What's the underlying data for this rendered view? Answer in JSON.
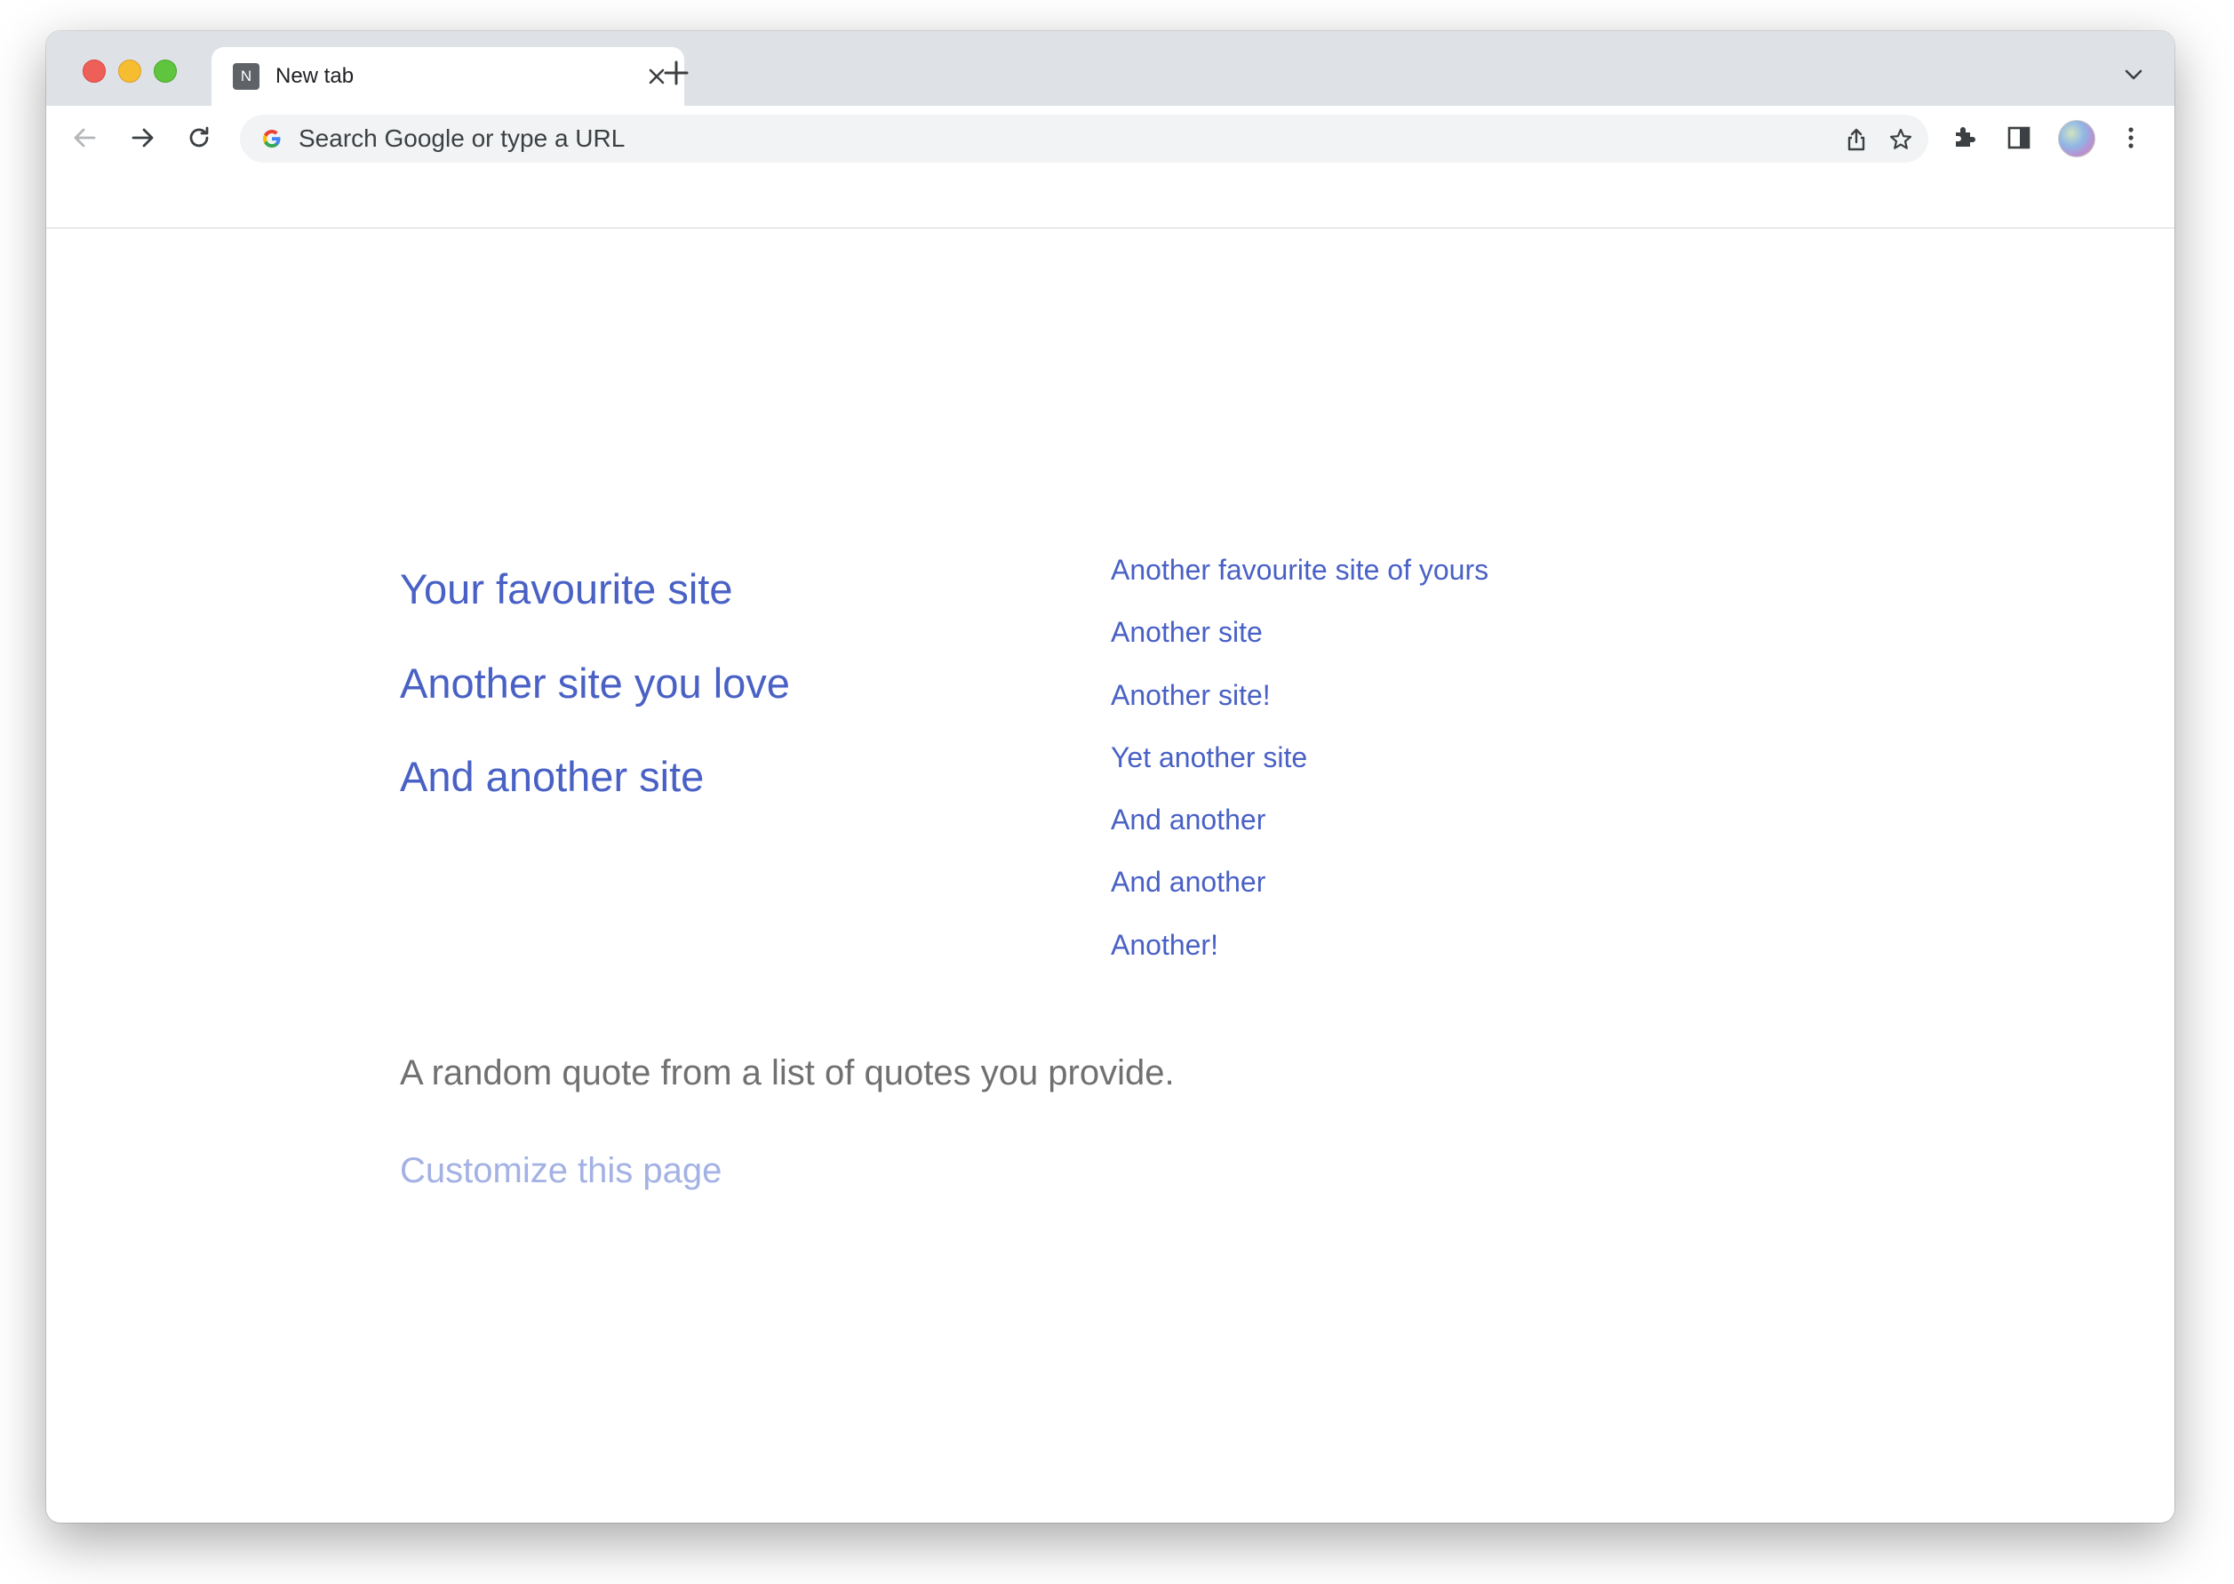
{
  "browser": {
    "tab": {
      "favicon_letter": "N",
      "title": "New tab"
    },
    "omnibox": {
      "placeholder": "Search Google or type a URL"
    }
  },
  "page": {
    "favourite_links": [
      "Your favourite site",
      "Another site you love",
      "And another site"
    ],
    "other_links": [
      "Another favourite site of yours",
      "Another site",
      "Another site!",
      "Yet another site",
      "And another",
      "And another",
      "Another!"
    ],
    "quote": "A random quote from a list of quotes you provide.",
    "customize_label": "Customize this page"
  },
  "colors": {
    "link": "#4961c5",
    "customize": "#a3b1e4",
    "quote": "#707070",
    "tabstrip": "#dee1e6"
  },
  "icons": {
    "toolbar": [
      "back-arrow-icon",
      "forward-arrow-icon",
      "reload-icon",
      "google-icon",
      "share-icon",
      "star-icon",
      "extensions-icon",
      "side-panel-icon",
      "avatar",
      "more-menu-icon"
    ]
  }
}
